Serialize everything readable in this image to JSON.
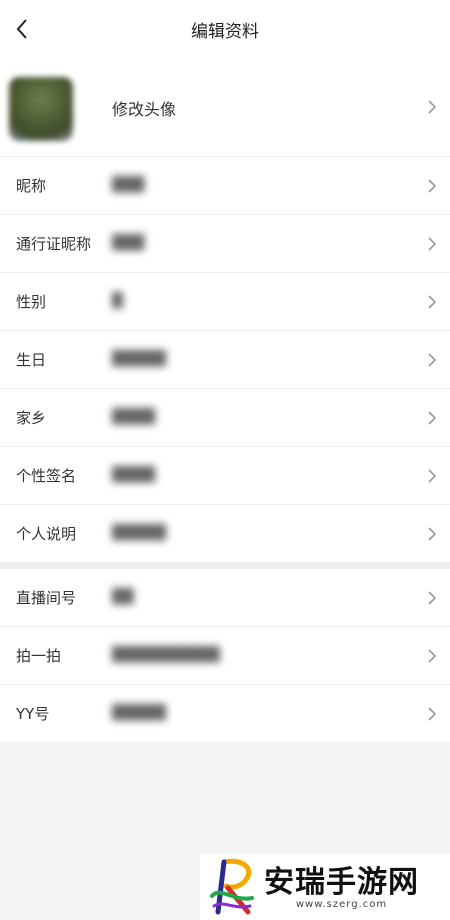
{
  "header": {
    "title": "编辑资料"
  },
  "avatar_row": {
    "label": "修改头像"
  },
  "profile_rows": [
    {
      "label": "昵称",
      "value": "███"
    },
    {
      "label": "通行证昵称",
      "value": "███"
    },
    {
      "label": "性别",
      "value": "█"
    },
    {
      "label": "生日",
      "value": "█████"
    },
    {
      "label": "家乡",
      "value": "████"
    },
    {
      "label": "个性签名",
      "value": "████"
    },
    {
      "label": "个人说明",
      "value": "█████"
    }
  ],
  "account_rows": [
    {
      "label": "直播间号",
      "value": "██"
    },
    {
      "label": "拍一拍",
      "value": "██████████"
    },
    {
      "label": "YY号",
      "value": "█████"
    }
  ],
  "watermark": {
    "name": "安瑞手游网",
    "url": "www.szerg.com"
  },
  "colors": {
    "background": "#f4f4f4",
    "card": "#ffffff",
    "divider": "#eeeeee",
    "chevron": "#999999"
  },
  "icons": {
    "back": "back-arrow-icon",
    "row_arrow": "chevron-right-icon"
  }
}
